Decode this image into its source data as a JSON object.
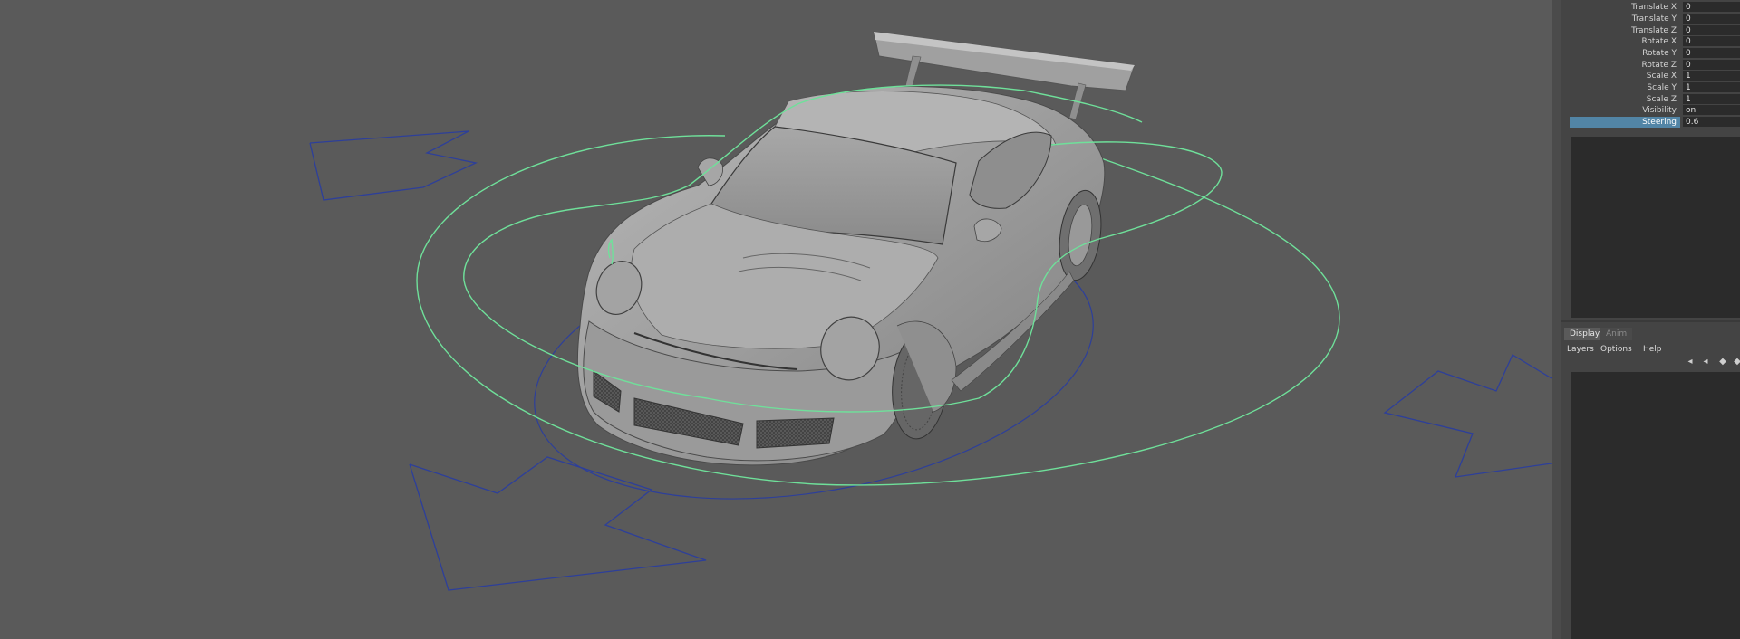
{
  "channel_box": {
    "attributes": [
      {
        "name": "Translate X",
        "value": "0"
      },
      {
        "name": "Translate Y",
        "value": "0"
      },
      {
        "name": "Translate Z",
        "value": "0"
      },
      {
        "name": "Rotate X",
        "value": "0"
      },
      {
        "name": "Rotate Y",
        "value": "0"
      },
      {
        "name": "Rotate Z",
        "value": "0"
      },
      {
        "name": "Scale X",
        "value": "1"
      },
      {
        "name": "Scale Y",
        "value": "1"
      },
      {
        "name": "Scale Z",
        "value": "1"
      },
      {
        "name": "Visibility",
        "value": "on"
      },
      {
        "name": "Steering",
        "value": "0.6",
        "selected": true
      }
    ],
    "selection_color": "#5285a6"
  },
  "layer_editor": {
    "tabs": [
      {
        "label": "Display",
        "active": true
      },
      {
        "label": "Anim",
        "active": false
      }
    ],
    "menu": [
      "Layers",
      "Options",
      "Help"
    ],
    "buttons": [
      "move-layer-up-icon",
      "move-layer-down-icon",
      "new-layer-icon",
      "new-layer-from-selection-icon"
    ]
  },
  "viewport": {
    "background": "#5a5a5a",
    "control_colors": {
      "wheel_control": "#6fe09a",
      "arrow_control": "#2d3f9a"
    },
    "content": "car-model"
  }
}
